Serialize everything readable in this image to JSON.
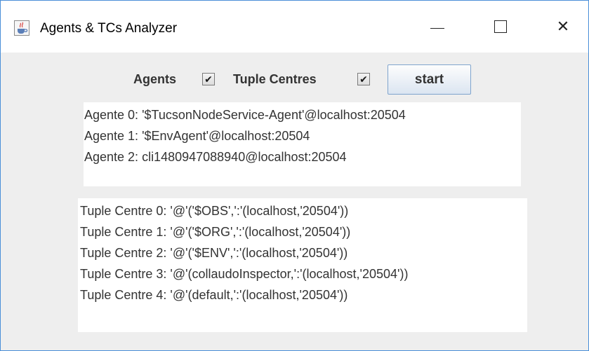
{
  "window": {
    "title": "Agents & TCs Analyzer",
    "minimize_glyph": "—",
    "close_glyph": "✕"
  },
  "toolbar": {
    "agents_label": "Agents",
    "agents_checked": true,
    "tuple_centres_label": "Tuple Centres",
    "tuple_centres_checked": true,
    "checkmark": "✔",
    "start_label": "start"
  },
  "agents": [
    "Agente 0: '$TucsonNodeService-Agent'@localhost:20504",
    "Agente 1: '$EnvAgent'@localhost:20504",
    "Agente 2: cli1480947088940@localhost:20504"
  ],
  "tuple_centres": [
    "Tuple Centre 0: '@'('$OBS',':'(localhost,'20504'))",
    "Tuple Centre 1: '@'('$ORG',':'(localhost,'20504'))",
    "Tuple Centre 2: '@'('$ENV',':'(localhost,'20504'))",
    "Tuple Centre 3: '@'(collaudoInspector,':'(localhost,'20504'))",
    "Tuple Centre 4: '@'(default,':'(localhost,'20504'))"
  ],
  "icons": {
    "app": "java-coffee-cup-icon",
    "minimize": "minimize-icon",
    "maximize": "maximize-icon",
    "close": "close-icon"
  }
}
